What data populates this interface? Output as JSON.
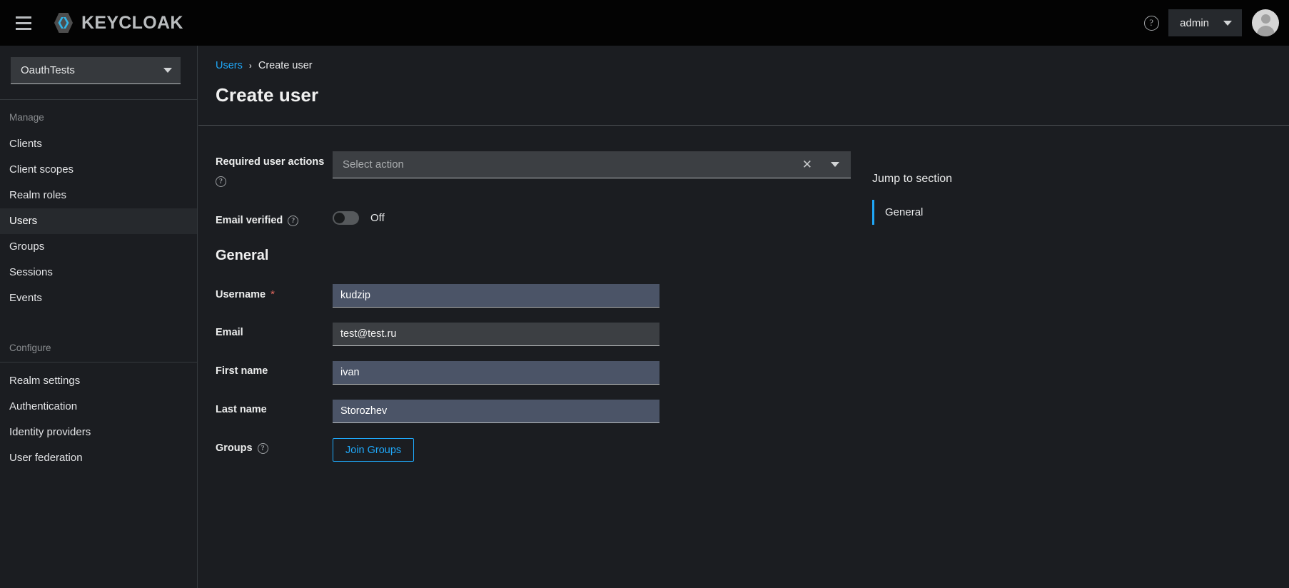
{
  "masthead": {
    "nav_toggle_label": "Global navigation",
    "brand_text": "KEYCLOAK",
    "help_glyph": "?",
    "user_name": "admin"
  },
  "sidebar": {
    "realm": {
      "selected": "OauthTests"
    },
    "groups": [
      {
        "title": "Manage",
        "items": [
          {
            "label": "Clients",
            "active": false
          },
          {
            "label": "Client scopes",
            "active": false
          },
          {
            "label": "Realm roles",
            "active": false
          },
          {
            "label": "Users",
            "active": true
          },
          {
            "label": "Groups",
            "active": false
          },
          {
            "label": "Sessions",
            "active": false
          },
          {
            "label": "Events",
            "active": false
          }
        ]
      },
      {
        "title": "Configure",
        "items": [
          {
            "label": "Realm settings",
            "active": false
          },
          {
            "label": "Authentication",
            "active": false
          },
          {
            "label": "Identity providers",
            "active": false
          },
          {
            "label": "User federation",
            "active": false
          }
        ]
      }
    ]
  },
  "page": {
    "breadcrumb": {
      "parent": "Users",
      "separator": "›",
      "current": "Create user"
    },
    "title": "Create user"
  },
  "form": {
    "required_user_actions": {
      "label": "Required user actions",
      "hint_glyph": "?",
      "placeholder": "Select action",
      "value": "",
      "clear_glyph": "✕"
    },
    "email_verified": {
      "label": "Email verified",
      "hint_glyph": "?",
      "state_label": "Off",
      "on": false
    },
    "general_section_title": "General",
    "username": {
      "label": "Username",
      "required_marker": "*",
      "value": "kudzip",
      "placeholder": ""
    },
    "email": {
      "label": "Email",
      "value": "test@test.ru",
      "placeholder": ""
    },
    "first_name": {
      "label": "First name",
      "value": "ivan",
      "placeholder": ""
    },
    "last_name": {
      "label": "Last name",
      "value": "Storozhev",
      "placeholder": ""
    },
    "groups": {
      "label": "Groups",
      "hint_glyph": "?",
      "button_label": "Join Groups"
    }
  },
  "jump_to_section": {
    "title": "Jump to section",
    "items": [
      {
        "label": "General",
        "active": true
      }
    ]
  },
  "colors": {
    "accent_blue": "#1fa7f8",
    "masthead_bg": "#030303",
    "page_bg": "#1b1d21",
    "input_bg": "#3c3f43",
    "autofill_bg": "#4b5467",
    "required_red": "#e4695f"
  }
}
